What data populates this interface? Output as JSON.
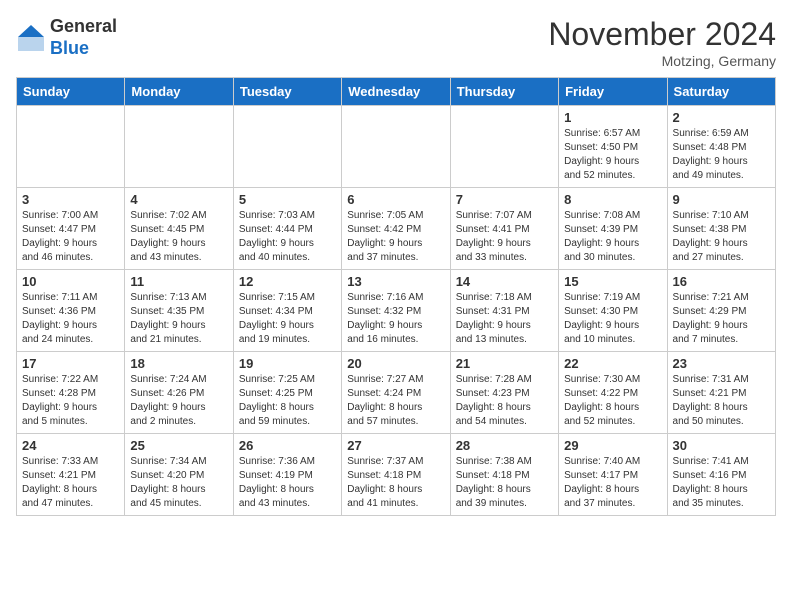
{
  "logo": {
    "general": "General",
    "blue": "Blue"
  },
  "title": "November 2024",
  "location": "Motzing, Germany",
  "weekdays": [
    "Sunday",
    "Monday",
    "Tuesday",
    "Wednesday",
    "Thursday",
    "Friday",
    "Saturday"
  ],
  "weeks": [
    [
      {
        "day": "",
        "info": ""
      },
      {
        "day": "",
        "info": ""
      },
      {
        "day": "",
        "info": ""
      },
      {
        "day": "",
        "info": ""
      },
      {
        "day": "",
        "info": ""
      },
      {
        "day": "1",
        "info": "Sunrise: 6:57 AM\nSunset: 4:50 PM\nDaylight: 9 hours\nand 52 minutes."
      },
      {
        "day": "2",
        "info": "Sunrise: 6:59 AM\nSunset: 4:48 PM\nDaylight: 9 hours\nand 49 minutes."
      }
    ],
    [
      {
        "day": "3",
        "info": "Sunrise: 7:00 AM\nSunset: 4:47 PM\nDaylight: 9 hours\nand 46 minutes."
      },
      {
        "day": "4",
        "info": "Sunrise: 7:02 AM\nSunset: 4:45 PM\nDaylight: 9 hours\nand 43 minutes."
      },
      {
        "day": "5",
        "info": "Sunrise: 7:03 AM\nSunset: 4:44 PM\nDaylight: 9 hours\nand 40 minutes."
      },
      {
        "day": "6",
        "info": "Sunrise: 7:05 AM\nSunset: 4:42 PM\nDaylight: 9 hours\nand 37 minutes."
      },
      {
        "day": "7",
        "info": "Sunrise: 7:07 AM\nSunset: 4:41 PM\nDaylight: 9 hours\nand 33 minutes."
      },
      {
        "day": "8",
        "info": "Sunrise: 7:08 AM\nSunset: 4:39 PM\nDaylight: 9 hours\nand 30 minutes."
      },
      {
        "day": "9",
        "info": "Sunrise: 7:10 AM\nSunset: 4:38 PM\nDaylight: 9 hours\nand 27 minutes."
      }
    ],
    [
      {
        "day": "10",
        "info": "Sunrise: 7:11 AM\nSunset: 4:36 PM\nDaylight: 9 hours\nand 24 minutes."
      },
      {
        "day": "11",
        "info": "Sunrise: 7:13 AM\nSunset: 4:35 PM\nDaylight: 9 hours\nand 21 minutes."
      },
      {
        "day": "12",
        "info": "Sunrise: 7:15 AM\nSunset: 4:34 PM\nDaylight: 9 hours\nand 19 minutes."
      },
      {
        "day": "13",
        "info": "Sunrise: 7:16 AM\nSunset: 4:32 PM\nDaylight: 9 hours\nand 16 minutes."
      },
      {
        "day": "14",
        "info": "Sunrise: 7:18 AM\nSunset: 4:31 PM\nDaylight: 9 hours\nand 13 minutes."
      },
      {
        "day": "15",
        "info": "Sunrise: 7:19 AM\nSunset: 4:30 PM\nDaylight: 9 hours\nand 10 minutes."
      },
      {
        "day": "16",
        "info": "Sunrise: 7:21 AM\nSunset: 4:29 PM\nDaylight: 9 hours\nand 7 minutes."
      }
    ],
    [
      {
        "day": "17",
        "info": "Sunrise: 7:22 AM\nSunset: 4:28 PM\nDaylight: 9 hours\nand 5 minutes."
      },
      {
        "day": "18",
        "info": "Sunrise: 7:24 AM\nSunset: 4:26 PM\nDaylight: 9 hours\nand 2 minutes."
      },
      {
        "day": "19",
        "info": "Sunrise: 7:25 AM\nSunset: 4:25 PM\nDaylight: 8 hours\nand 59 minutes."
      },
      {
        "day": "20",
        "info": "Sunrise: 7:27 AM\nSunset: 4:24 PM\nDaylight: 8 hours\nand 57 minutes."
      },
      {
        "day": "21",
        "info": "Sunrise: 7:28 AM\nSunset: 4:23 PM\nDaylight: 8 hours\nand 54 minutes."
      },
      {
        "day": "22",
        "info": "Sunrise: 7:30 AM\nSunset: 4:22 PM\nDaylight: 8 hours\nand 52 minutes."
      },
      {
        "day": "23",
        "info": "Sunrise: 7:31 AM\nSunset: 4:21 PM\nDaylight: 8 hours\nand 50 minutes."
      }
    ],
    [
      {
        "day": "24",
        "info": "Sunrise: 7:33 AM\nSunset: 4:21 PM\nDaylight: 8 hours\nand 47 minutes."
      },
      {
        "day": "25",
        "info": "Sunrise: 7:34 AM\nSunset: 4:20 PM\nDaylight: 8 hours\nand 45 minutes."
      },
      {
        "day": "26",
        "info": "Sunrise: 7:36 AM\nSunset: 4:19 PM\nDaylight: 8 hours\nand 43 minutes."
      },
      {
        "day": "27",
        "info": "Sunrise: 7:37 AM\nSunset: 4:18 PM\nDaylight: 8 hours\nand 41 minutes."
      },
      {
        "day": "28",
        "info": "Sunrise: 7:38 AM\nSunset: 4:18 PM\nDaylight: 8 hours\nand 39 minutes."
      },
      {
        "day": "29",
        "info": "Sunrise: 7:40 AM\nSunset: 4:17 PM\nDaylight: 8 hours\nand 37 minutes."
      },
      {
        "day": "30",
        "info": "Sunrise: 7:41 AM\nSunset: 4:16 PM\nDaylight: 8 hours\nand 35 minutes."
      }
    ]
  ]
}
